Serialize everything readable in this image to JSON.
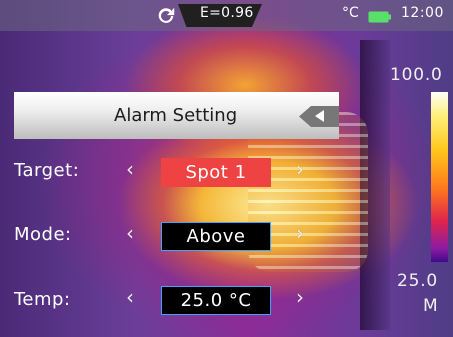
{
  "status": {
    "emissivity": "E=0.96",
    "unit": "°C",
    "time": "12:00",
    "refresh_icon": "refresh-icon",
    "battery_icon": "battery-icon"
  },
  "scale": {
    "max": "100.0",
    "min": "25.0",
    "mode": "M",
    "palette": "ironbow"
  },
  "menu": {
    "title": "Alarm Setting",
    "back_icon": "back-icon",
    "rows": [
      {
        "label": "Target:",
        "value": "Spot 1",
        "left_icon": "chevron-left-icon",
        "right_icon": "chevron-right-icon",
        "selected": true
      },
      {
        "label": "Mode:",
        "value": "Above",
        "left_icon": "chevron-left-icon",
        "right_icon": "chevron-right-icon"
      },
      {
        "label": "Temp:",
        "value": "25.0 °C",
        "left_icon": "chevron-left-icon",
        "right_icon": "chevron-right-icon"
      }
    ]
  },
  "colors": {
    "selected_value_bg": "#ef4242",
    "value_border": "#3fa4ff",
    "header_bg": "#efefef"
  }
}
